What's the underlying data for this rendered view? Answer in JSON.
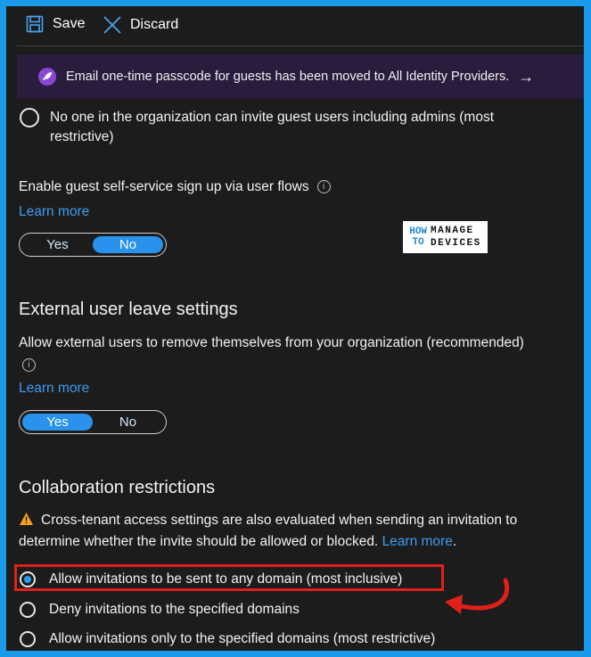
{
  "toolbar": {
    "save_label": "Save",
    "discard_label": "Discard"
  },
  "banner": {
    "text": "Email one-time passcode for guests has been moved to All Identity Providers.",
    "arrow": "→",
    "icon": "rocket-icon"
  },
  "guest_invite": {
    "option_most_restrictive": "No one in the organization can invite guest users including admins (most restrictive)"
  },
  "self_service": {
    "label": "Enable guest self-service sign up via user flows",
    "learn_more": "Learn more",
    "toggle": {
      "yes": "Yes",
      "no": "No",
      "selected": "No"
    }
  },
  "logo": {
    "left_top": "HOW",
    "left_bottom": "TO",
    "right_top": "MANAGE",
    "right_bottom": "DEVICES"
  },
  "external_leave": {
    "heading": "External user leave settings",
    "label": "Allow external users to remove themselves from your organization (recommended)",
    "learn_more": "Learn more",
    "toggle": {
      "yes": "Yes",
      "no": "No",
      "selected": "Yes"
    }
  },
  "collaboration": {
    "heading": "Collaboration restrictions",
    "warning_text": "Cross-tenant access settings are also evaluated when sending an invitation to determine whether the invite should be allowed or blocked.",
    "warning_link": "Learn more",
    "warning_tail": ".",
    "options": [
      "Allow invitations to be sent to any domain (most inclusive)",
      "Deny invitations to the specified domains",
      "Allow invitations only to the specified domains (most restrictive)"
    ],
    "selected_index": 0
  },
  "colors": {
    "accent": "#2892ec",
    "link": "#3d9cf0",
    "highlight": "#e0201b",
    "frame": "#1a9bea",
    "warning": "#f7a21b"
  }
}
